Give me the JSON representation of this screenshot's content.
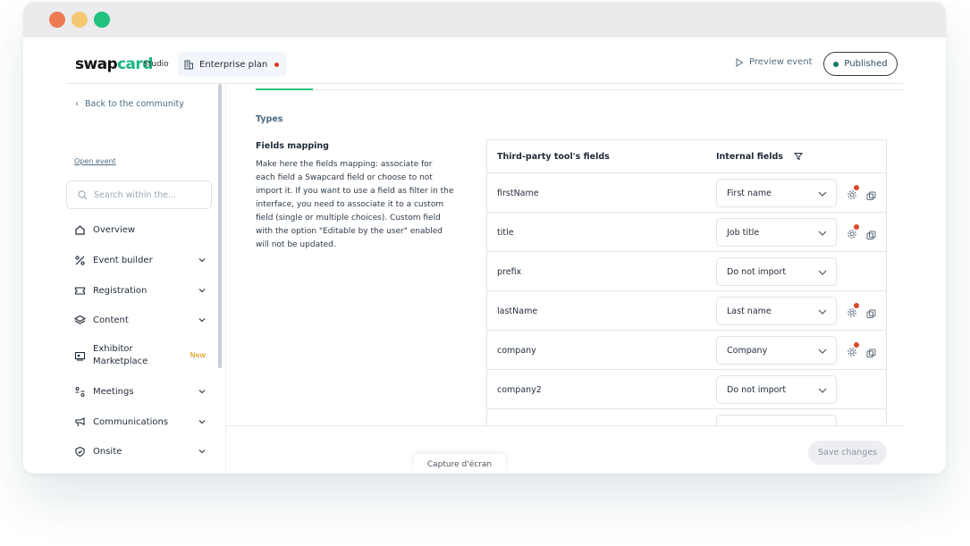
{
  "window": {
    "controls": [
      "close",
      "minimize",
      "maximize"
    ]
  },
  "header": {
    "logo_main": "swap",
    "logo_accent": "card",
    "studio_label": "Studio",
    "plan_label": "Enterprise plan",
    "preview_label": "Preview event",
    "published_label": "Published"
  },
  "sidebar": {
    "back_label": "Back to the community",
    "open_event_label": "Open event",
    "search_placeholder": "Search within the...",
    "items": [
      {
        "label": "Overview",
        "icon": "home-icon",
        "caret": false
      },
      {
        "label": "Event builder",
        "icon": "tools-icon",
        "caret": true
      },
      {
        "label": "Registration",
        "icon": "ticket-icon",
        "caret": true
      },
      {
        "label": "Content",
        "icon": "layers-icon",
        "caret": true
      },
      {
        "label": "Exhibitor Marketplace",
        "line1": "Exhibitor",
        "line2": "Marketplace",
        "icon": "booth-icon",
        "badge": "New"
      },
      {
        "label": "Meetings",
        "icon": "meetings-icon",
        "caret": true
      },
      {
        "label": "Communications",
        "icon": "megaphone-icon",
        "caret": true
      },
      {
        "label": "Onsite",
        "icon": "badge-check-icon",
        "caret": true
      }
    ]
  },
  "main": {
    "section_label": "Types",
    "fields_mapping": {
      "title": "Fields mapping",
      "description": "Make here the fields mapping: associate for each field a Swapcard field or choose to not import it. If you want to use a field as filter in the interface, you need to associate it to a custom field (single or multiple choices). Custom field with the option \"Editable by the user\" enabled will not be updated."
    },
    "table": {
      "col_third_party": "Third-party tool's fields",
      "col_internal": "Internal fields",
      "rows": [
        {
          "field": "firstName",
          "internal": "First name",
          "actions": true
        },
        {
          "field": "title",
          "internal": "Job title",
          "actions": true
        },
        {
          "field": "prefix",
          "internal": "Do not import",
          "actions": false
        },
        {
          "field": "lastName",
          "internal": "Last name",
          "actions": true
        },
        {
          "field": "company",
          "internal": "Company",
          "actions": true
        },
        {
          "field": "company2",
          "internal": "Do not import",
          "actions": false
        }
      ]
    },
    "save_label": "Save changes",
    "capture_label": "Capture d'écran"
  },
  "colors": {
    "accent_green": "#21c180",
    "alert_red": "#d93a25",
    "published_dot": "#0f7a6a",
    "new_badge": "#d98a00"
  }
}
